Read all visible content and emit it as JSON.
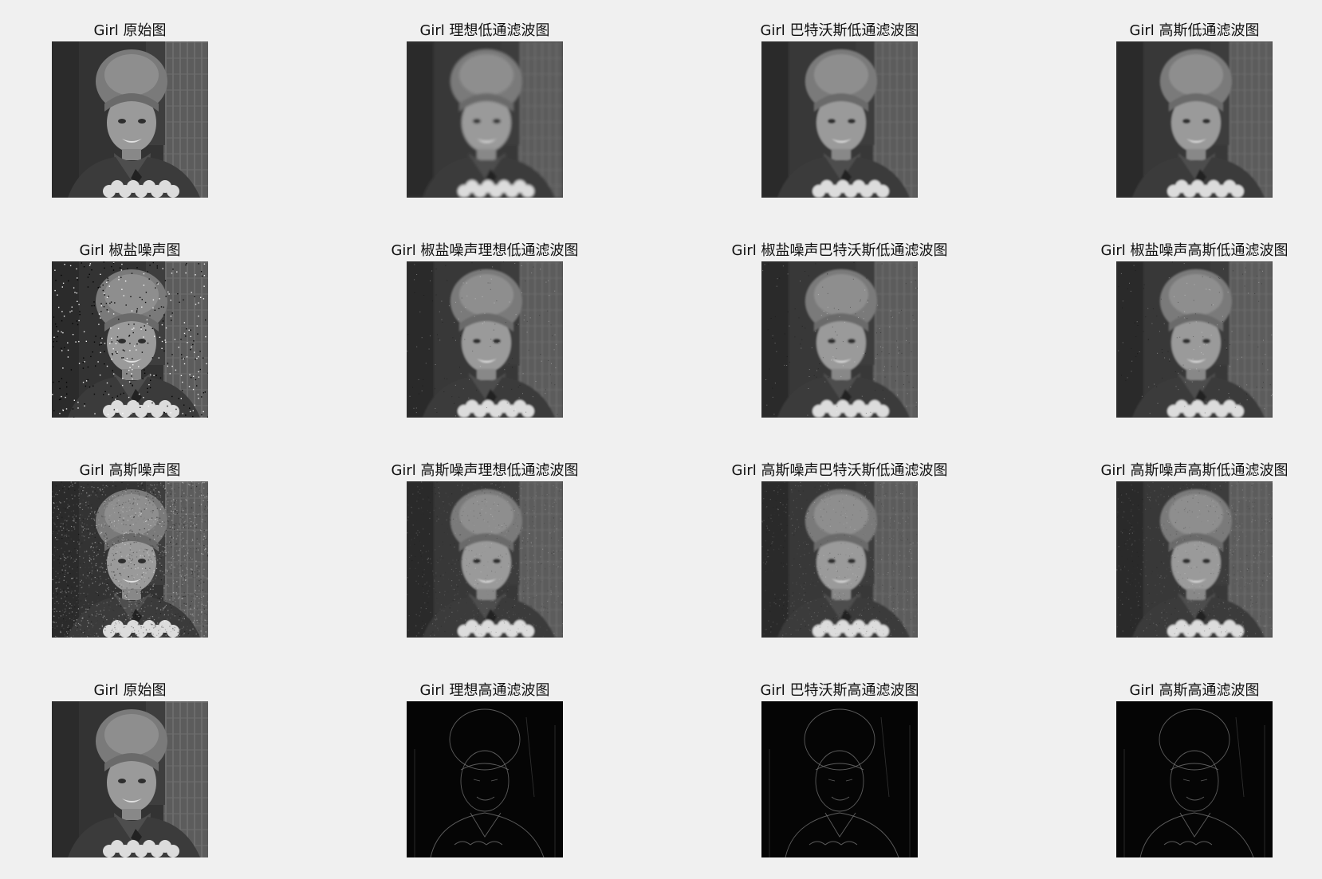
{
  "figure": {
    "background": "#f0f0f0",
    "subplots": [
      {
        "title": "Girl 原始图",
        "variant": "original"
      },
      {
        "title": "Girl 理想低通滤波图",
        "variant": "blur"
      },
      {
        "title": "Girl 巴特沃斯低通滤波图",
        "variant": "blur-light"
      },
      {
        "title": "Girl 高斯低通滤波图",
        "variant": "blur-light"
      },
      {
        "title": "Girl 椒盐噪声图",
        "variant": "saltpepper"
      },
      {
        "title": "Girl 椒盐噪声理想低通滤波图",
        "variant": "blur-noise"
      },
      {
        "title": "Girl 椒盐噪声巴特沃斯低通滤波图",
        "variant": "blur-noise"
      },
      {
        "title": "Girl 椒盐噪声高斯低通滤波图",
        "variant": "blur-noise"
      },
      {
        "title": "Girl 高斯噪声图",
        "variant": "gaussnoise"
      },
      {
        "title": "Girl 高斯噪声理想低通滤波图",
        "variant": "blur-gauss"
      },
      {
        "title": "Girl 高斯噪声巴特沃斯低通滤波图",
        "variant": "blur-gauss"
      },
      {
        "title": "Girl 高斯噪声高斯低通滤波图",
        "variant": "blur-gauss"
      },
      {
        "title": "Girl 原始图",
        "variant": "original"
      },
      {
        "title": "Girl 理想高通滤波图",
        "variant": "highpass"
      },
      {
        "title": "Girl 巴特沃斯高通滤波图",
        "variant": "highpass"
      },
      {
        "title": "Girl 高斯高通滤波图",
        "variant": "highpass"
      }
    ]
  }
}
